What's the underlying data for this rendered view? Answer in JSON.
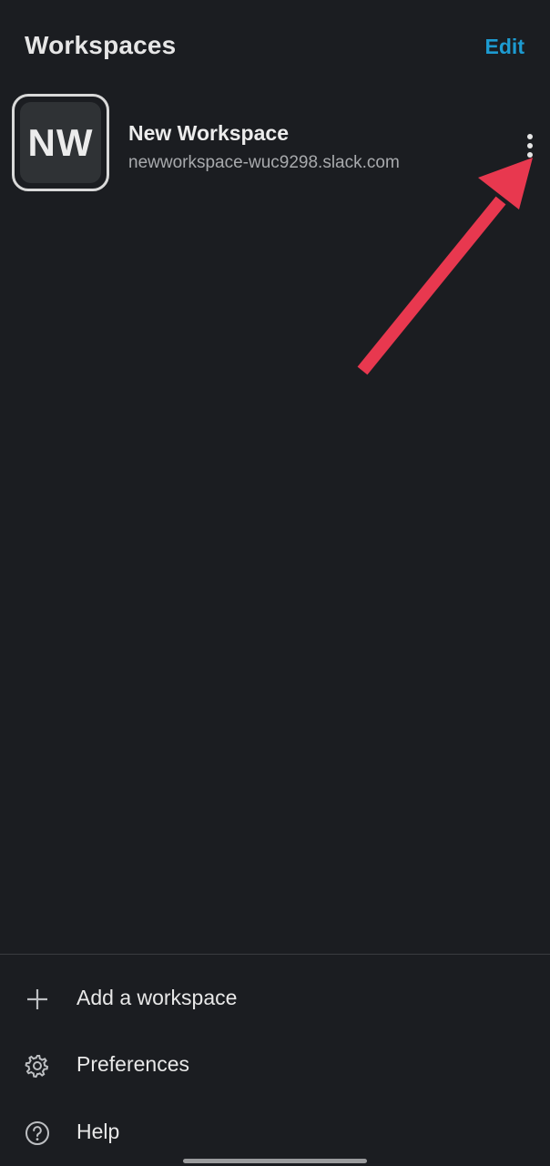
{
  "header": {
    "title": "Workspaces",
    "edit_label": "Edit"
  },
  "workspace": {
    "initials": "NW",
    "name": "New Workspace",
    "url": "newworkspace-wuc9298.slack.com",
    "more_icon": "kebab-vertical-icon"
  },
  "annotation": {
    "arrow_color": "#e8384f"
  },
  "menu": {
    "items": [
      {
        "label": "Add a workspace",
        "icon": "plus-icon"
      },
      {
        "label": "Preferences",
        "icon": "gear-icon"
      },
      {
        "label": "Help",
        "icon": "help-circle-icon"
      }
    ]
  },
  "colors": {
    "background": "#1b1d21",
    "accent": "#1d9bd1",
    "text": "#e8e8e8",
    "subtext": "#a8aaad"
  }
}
